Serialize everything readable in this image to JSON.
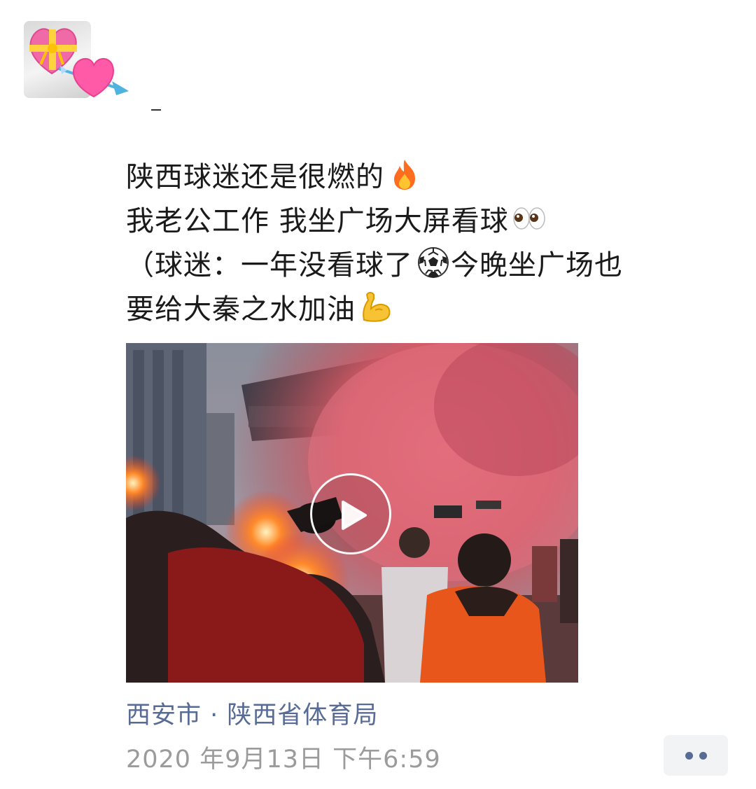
{
  "post": {
    "text_lines": [
      "陕西球迷还是很燃的",
      "我老公工作 我坐广场大屏看球",
      "（球迷：一年没看球了",
      "今晚坐广场也",
      "要给大秦之水加油"
    ],
    "emojis": [
      "fire-emoji",
      "eyes-emoji",
      "soccer-ball-emoji",
      "flexed-biceps-emoji"
    ]
  },
  "avatar": {
    "icons": [
      "heart-with-ribbon-icon",
      "heart-with-arrow-icon"
    ]
  },
  "video": {
    "play_icon": "play-icon"
  },
  "location": {
    "label": "西安市 · 陕西省体育局"
  },
  "timestamp": {
    "label": "2020 年9月13日 下午6:59"
  },
  "actions": {
    "more_icon": "more-dots-icon"
  },
  "colors": {
    "link": "#576b95",
    "text": "#1a1a1a",
    "meta": "#9b9b9b",
    "more_bg": "#f2f3f5"
  }
}
